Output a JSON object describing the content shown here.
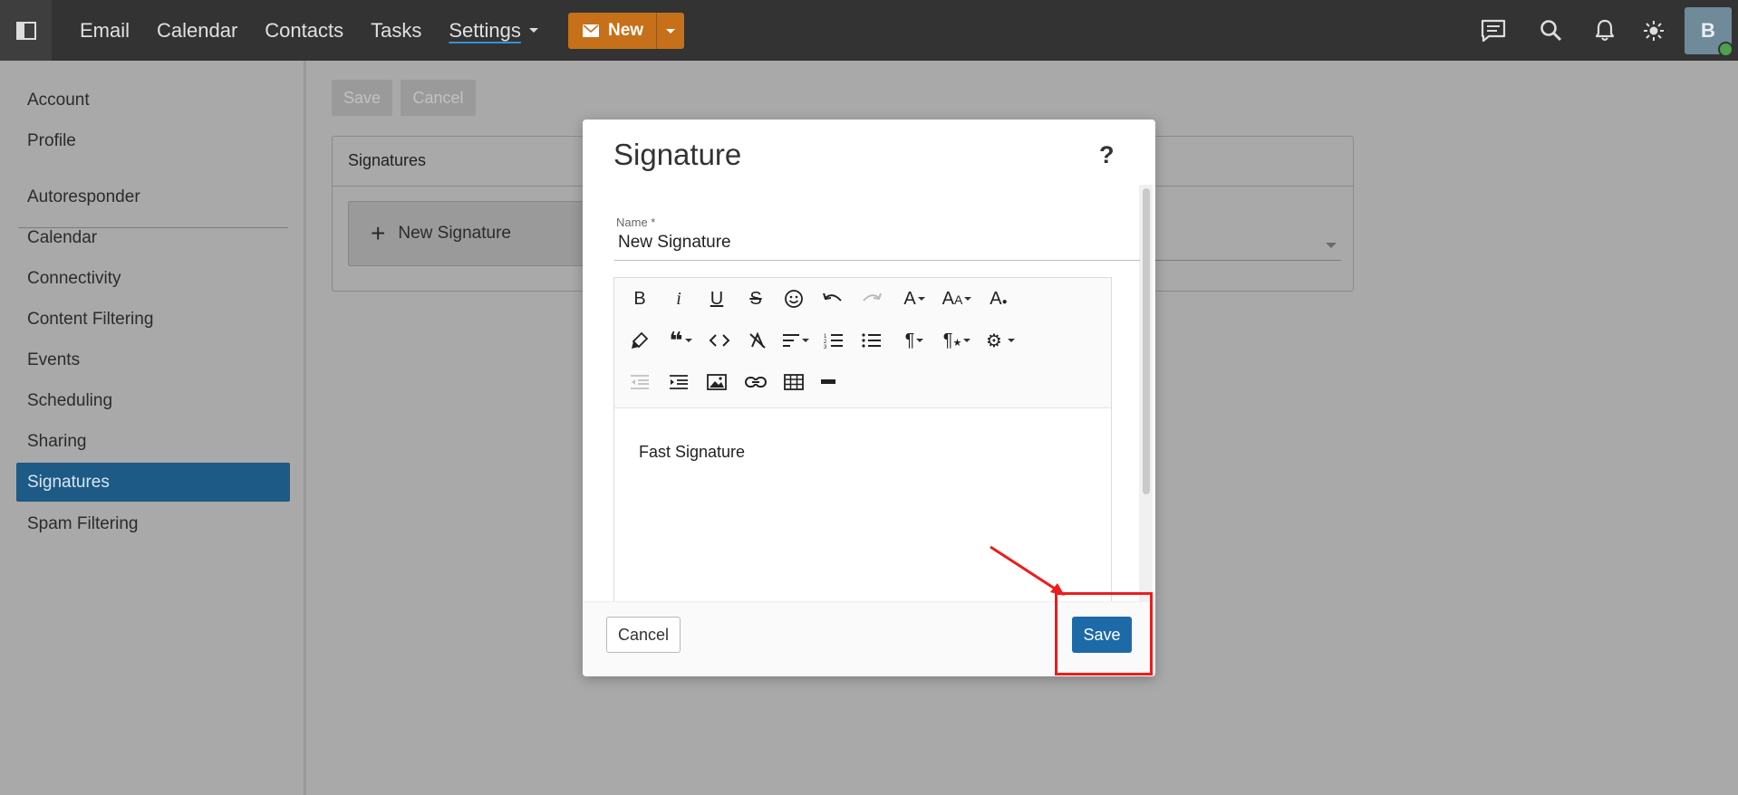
{
  "topbar": {
    "nav": [
      {
        "label": "Email"
      },
      {
        "label": "Calendar"
      },
      {
        "label": "Contacts"
      },
      {
        "label": "Tasks"
      },
      {
        "label": "Settings"
      }
    ],
    "new_button_label": "New",
    "avatar_initial": "B",
    "icons": [
      "sidebar-toggle-icon",
      "chat-icon",
      "search-icon",
      "bell-icon",
      "sun-icon"
    ]
  },
  "sidebar": {
    "items": [
      {
        "label": "Account"
      },
      {
        "label": "Profile"
      },
      {
        "label": "Autoresponder"
      },
      {
        "label": "Calendar"
      },
      {
        "label": "Connectivity"
      },
      {
        "label": "Content Filtering"
      },
      {
        "label": "Events"
      },
      {
        "label": "Scheduling"
      },
      {
        "label": "Sharing"
      },
      {
        "label": "Signatures"
      },
      {
        "label": "Spam Filtering"
      }
    ],
    "selected": "Signatures"
  },
  "page": {
    "save_label": "Save",
    "cancel_label": "Cancel",
    "panel_title": "Signatures",
    "new_signature_label": "New Signature"
  },
  "modal": {
    "title": "Signature",
    "help": "?",
    "name_label": "Name *",
    "name_value": "New Signature",
    "editor_text": "Fast Signature",
    "cancel_label": "Cancel",
    "save_label": "Save"
  },
  "colors": {
    "topbar": "#333333",
    "accent_new": "#c7701a",
    "selected_nav": "#1d5a86",
    "primary_button": "#1e6aa8",
    "annotation": "#ee1c1c"
  }
}
